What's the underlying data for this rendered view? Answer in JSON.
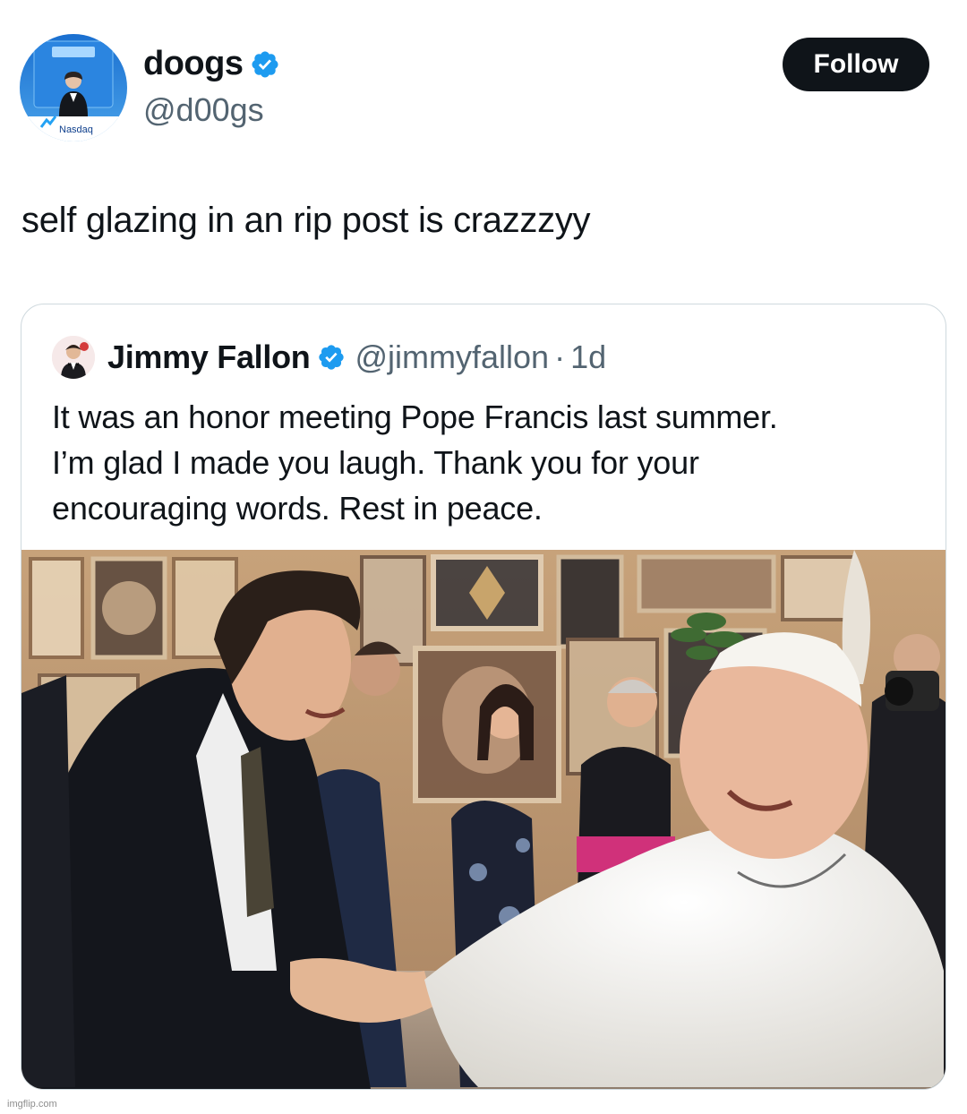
{
  "author": {
    "display_name": "doogs",
    "handle": "@d00gs",
    "verified": true,
    "avatar_text": "Nasdaq"
  },
  "follow_label": "Follow",
  "tweet_text": "self glazing in an rip post is crazzzyy",
  "quoted": {
    "display_name": "Jimmy Fallon",
    "handle": "@jimmyfallon",
    "separator": "·",
    "time": "1d",
    "verified": true,
    "text_lines": [
      "It was an honor meeting Pope Francis last summer.",
      "I’m glad I made you laugh. Thank you for your",
      "encouraging words. Rest in peace."
    ]
  },
  "watermark": "imgflip.com",
  "colors": {
    "verified_blue": "#1d9bf0",
    "text_primary": "#0f1419",
    "text_secondary": "#536471",
    "follow_bg": "#0f1419",
    "card_border": "#cfd9de"
  },
  "icons": [
    "verified-badge-icon",
    "profile-avatar",
    "quoted-avatar",
    "attached-photo"
  ]
}
